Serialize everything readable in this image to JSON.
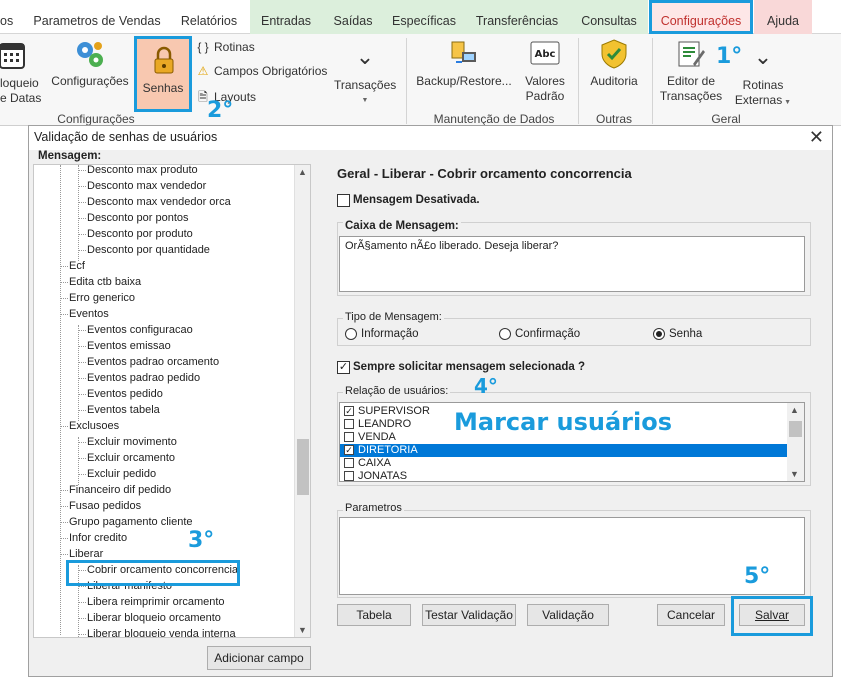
{
  "ribbon_tabs": [
    {
      "label": "os"
    },
    {
      "label": "Parametros de Vendas"
    },
    {
      "label": "Relatórios"
    },
    {
      "label": "Entradas"
    },
    {
      "label": "Saídas"
    },
    {
      "label": "Específicas"
    },
    {
      "label": "Transferências"
    },
    {
      "label": "Consultas"
    },
    {
      "label": "Configurações"
    },
    {
      "label": "Ajuda"
    }
  ],
  "ribbon": {
    "bloqueio_datas": "loqueio\nde Datas",
    "configuracoes": "Configurações",
    "senhas": "Senhas",
    "rotinas": "Rotinas",
    "campos_obrigatorios": "Campos Obrigatórios",
    "layouts": "Layouts",
    "transacoes": "Transações",
    "backup_restore": "Backup/Restore...",
    "valores_padrao_1": "Valores",
    "valores_padrao_2": "Padrão",
    "auditoria": "Auditoria",
    "editor_transacoes_1": "Editor de",
    "editor_transacoes_2": "Transações",
    "rotinas_externas_1": "Rotinas",
    "rotinas_externas_2": "Externas",
    "group_configuracoes": "Configurações",
    "group_manutencao": "Manutenção de Dados",
    "group_outras": "Outras",
    "group_geral": "Geral"
  },
  "annotations": {
    "step1": "1°",
    "step2": "2°",
    "step3": "3°",
    "step4": "4°",
    "step5": "5°",
    "marcar": "Marcar usuários"
  },
  "dialog": {
    "title": "Validação de senhas de usuários",
    "tree_header": "Mensagem:",
    "tree_items": [
      "Desconto max produto",
      "Desconto max vendedor",
      "Desconto max vendedor orca",
      "Desconto por pontos",
      "Desconto por produto",
      "Desconto por quantidade",
      "Ecf",
      "Edita ctb baixa",
      "Erro generico",
      "Eventos",
      "Eventos configuracao",
      "Eventos emissao",
      "Eventos padrao orcamento",
      "Eventos padrao pedido",
      "Eventos pedido",
      "Eventos tabela",
      "Exclusoes",
      "Excluir movimento",
      "Excluir orcamento",
      "Excluir pedido",
      "Financeiro dif pedido",
      "Fusao pedidos",
      "Grupo pagamento cliente",
      "Infor credito",
      "Liberar",
      "Cobrir orcamento concorrencia",
      "Liberar manifesto",
      "Libera reimprimir orcamento",
      "Liberar bloqueio orcamento",
      "Liberar bloqueio venda interna"
    ],
    "add_field": "Adicionar campo",
    "panel_title": "Geral - Liberar - Cobrir orcamento concorrencia",
    "msg_disabled": "Mensagem Desativada.",
    "msg_box_label": "Caixa de Mensagem:",
    "msg_text": "OrÃ§amento nÃ£o liberado. Deseja liberar?",
    "tipo_label": "Tipo de Mensagem:",
    "tipo_options": [
      "Informação",
      "Confirmação",
      "Senha"
    ],
    "tipo_selected": "Senha",
    "always_ask": "Sempre solicitar mensagem selecionada ?",
    "users_label": "Relação de usuários:",
    "users": [
      {
        "name": "SUPERVISOR",
        "checked": true
      },
      {
        "name": "LEANDRO",
        "checked": false
      },
      {
        "name": "VENDA",
        "checked": false
      },
      {
        "name": "DIRETORIA",
        "checked": true,
        "selected": true
      },
      {
        "name": "CAIXA",
        "checked": false
      },
      {
        "name": "JONATAS",
        "checked": false
      }
    ],
    "params_label": "Parametros",
    "buttons": {
      "tabela": "Tabela",
      "testar": "Testar Validação",
      "validacao": "Validação",
      "cancelar": "Cancelar",
      "salvar": "Salvar"
    }
  },
  "colors": {
    "accent": "#1a9bdc",
    "selection": "#0078d7",
    "active_tab_text": "#c0312e"
  }
}
